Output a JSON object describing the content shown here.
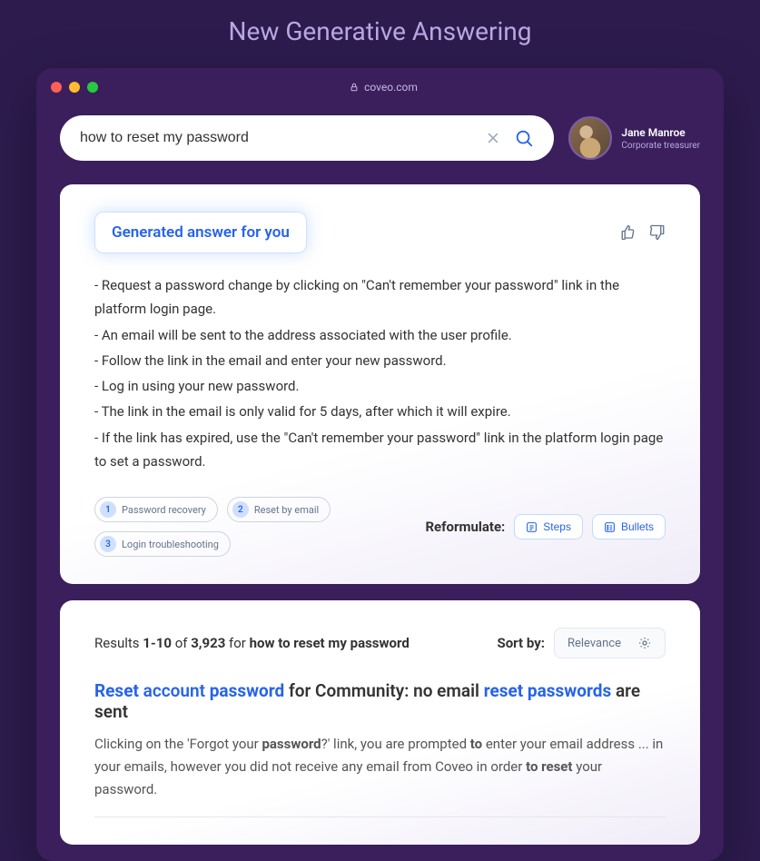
{
  "page_heading": "New Generative Answering",
  "browser": {
    "url_domain": "coveo.com"
  },
  "search": {
    "value": "how to reset my password"
  },
  "user": {
    "name": "Jane Manroe",
    "role": "Corporate treasurer"
  },
  "answer": {
    "badge": "Generated answer for you",
    "lines": [
      "- Request a password change by clicking on \"Can't remember your password\" link in the platform login page.",
      "- An email will be sent to the address associated with the user profile.",
      "- Follow the link in the email and enter your new password.",
      "- Log in using your new password.",
      "- The link in the email is only valid for 5 days, after which it will expire.",
      "- If the link has expired, use the \"Can't remember your password\" link in the platform login page to set a password."
    ],
    "tags": [
      {
        "num": "1",
        "label": "Password recovery"
      },
      {
        "num": "2",
        "label": "Reset by email"
      },
      {
        "num": "3",
        "label": "Login troubleshooting"
      }
    ],
    "reformulate_label": "Reformulate:",
    "reformulate_options": {
      "steps": "Steps",
      "bullets": "Bullets"
    }
  },
  "results": {
    "meta_prefix": "Results ",
    "range": "1-10",
    "of_text": " of ",
    "total": "3,923",
    "for_text": " for ",
    "query": "how to reset my password",
    "sort_label": "Sort by:",
    "sort_value": "Relevance",
    "first": {
      "t1": "Reset",
      "t2": " account ",
      "t3": "password",
      "t4": " for Community: no email ",
      "t5": "reset passwords",
      "t6": " are sent",
      "s1": "Clicking on the 'Forgot your ",
      "s2": "password",
      "s3": "?' link, you are prompted ",
      "s4": "to",
      "s5": " enter your email address ... in your emails, however you did not receive any email from Coveo in order ",
      "s6": "to reset",
      "s7": " your password."
    }
  }
}
